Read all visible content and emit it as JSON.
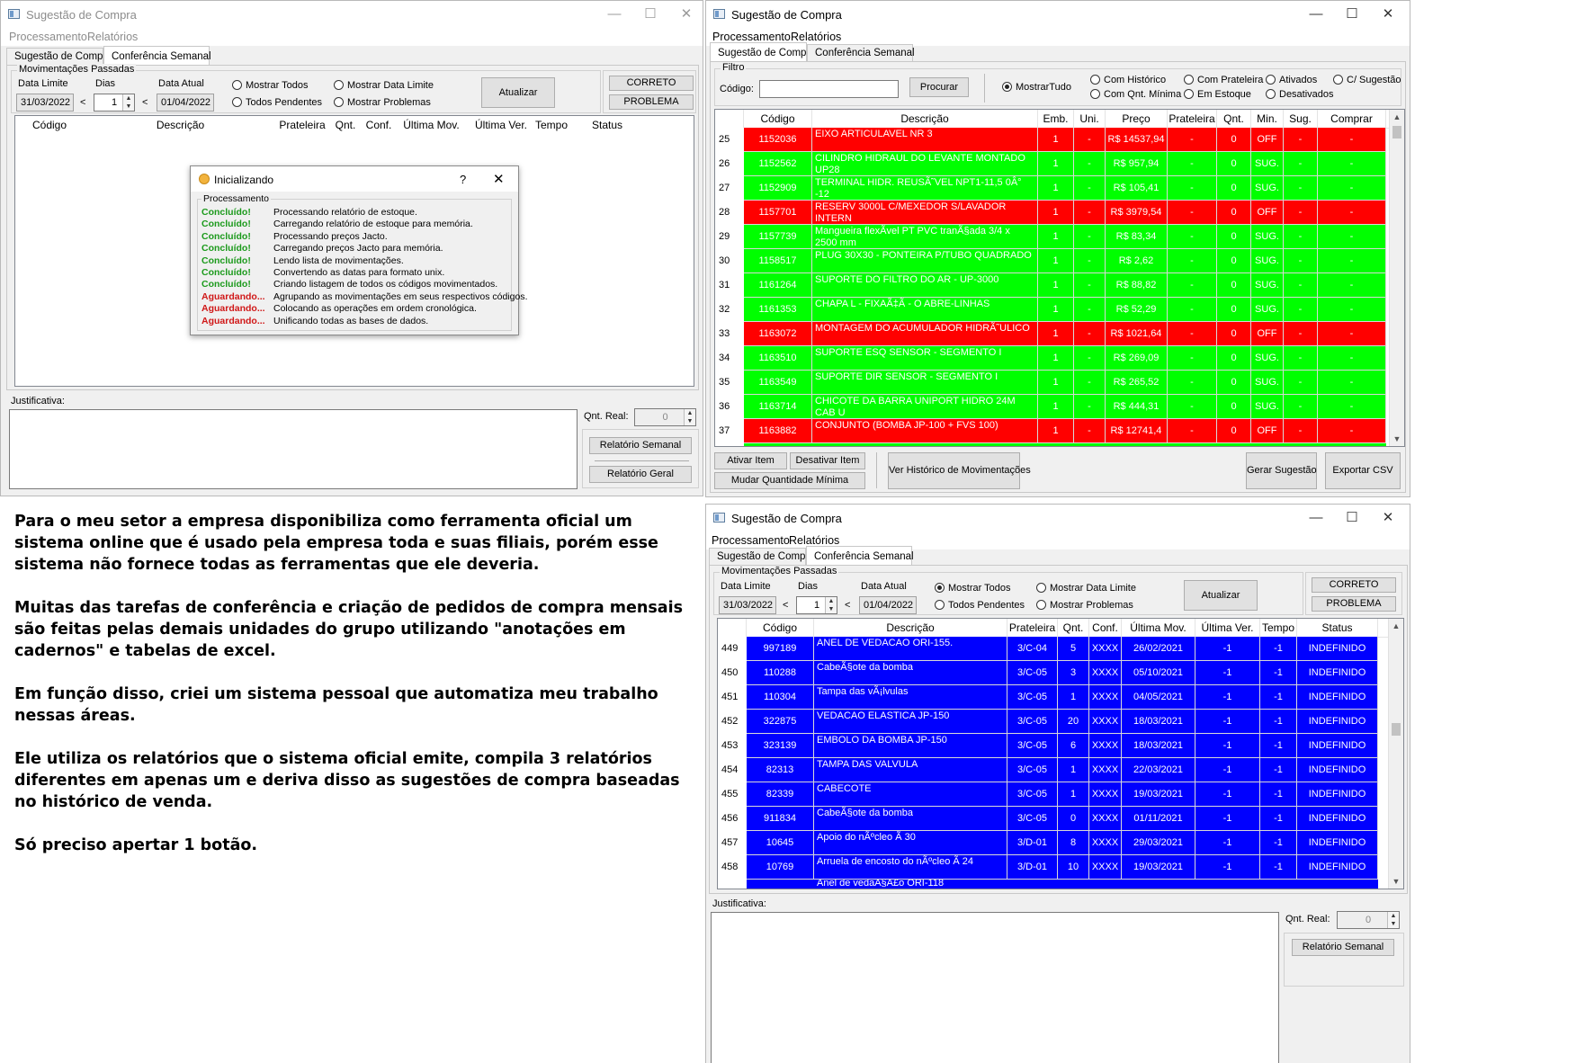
{
  "win1": {
    "title": "Sugestão de Compra",
    "menu": [
      "Processamento",
      "Relatórios"
    ],
    "tabs": [
      "Sugestão de Compra",
      "Conferência Semanal"
    ],
    "group_title": "Movimentações Passadas",
    "data_limite_label": "Data Limite",
    "dias_label": "Dias",
    "data_atual_label": "Data Atual",
    "data_limite": "31/03/2022",
    "dias": "1",
    "data_atual": "01/04/2022",
    "lt": "<",
    "radio_mostrar_todos": "Mostrar Todos",
    "radio_todos_pendentes": "Todos Pendentes",
    "radio_mostrar_data_limite": "Mostrar Data Limite",
    "radio_mostrar_problemas": "Mostrar Problemas",
    "atualizar": "Atualizar",
    "correto": "CORRETO",
    "problema": "PROBLEMA",
    "columns": [
      "Código",
      "Descrição",
      "Prateleira",
      "Qnt.",
      "Conf.",
      "Última Mov.",
      "Última Ver.",
      "Tempo",
      "Status"
    ],
    "justificativa": "Justificativa:",
    "qnt_real_label": "Qnt. Real:",
    "qnt_real": "0",
    "relatorio_semanal": "Relatório Semanal",
    "relatorio_geral": "Relatório Geral"
  },
  "dialog": {
    "title": "Inicializando",
    "help": "?",
    "close": "✕",
    "group": "Processamento",
    "lines": [
      {
        "status": "Concluído!",
        "text": "Processando relatório de estoque."
      },
      {
        "status": "Concluído!",
        "text": "Carregando relatório de estoque para memória."
      },
      {
        "status": "Concluído!",
        "text": "Processando preços Jacto."
      },
      {
        "status": "Concluído!",
        "text": "Carregando preços Jacto para memória."
      },
      {
        "status": "Concluído!",
        "text": "Lendo lista de movimentações."
      },
      {
        "status": "Concluído!",
        "text": "Convertendo as datas para formato unix."
      },
      {
        "status": "Concluído!",
        "text": "Criando listagem de todos os códigos movimentados."
      },
      {
        "status": "Aguardando...",
        "text": "Agrupando as movimentações em seus respectivos códigos."
      },
      {
        "status": "Aguardando...",
        "text": "Colocando as operações em ordem cronológica."
      },
      {
        "status": "Aguardando...",
        "text": "Unificando todas as bases de dados."
      }
    ]
  },
  "win2": {
    "title": "Sugestão de Compra",
    "menu": [
      "Processamento",
      "Relatórios"
    ],
    "tabs": [
      "Sugestão de Compra",
      "Conferência Semanal"
    ],
    "filtro": "Filtro",
    "codigo_label": "Código:",
    "codigo_value": "",
    "procurar": "Procurar",
    "radios": [
      "MostrarTudo",
      "Com Histórico",
      "Com Qnt. Mínima",
      "Com Prateleira",
      "Em Estoque",
      "Ativados",
      "Desativados",
      "C/ Sugestão"
    ],
    "columns": [
      "Código",
      "Descrição",
      "Emb.",
      "Uni.",
      "Preço",
      "Prateleira",
      "Qnt.",
      "Min.",
      "Sug.",
      "Comprar"
    ],
    "rows": [
      {
        "n": "25",
        "codigo": "1152036",
        "desc": "EIXO ARTICULAVEL NR 3",
        "emb": "1",
        "uni": "-",
        "preco": "R$ 14537,94",
        "prat": "-",
        "qnt": "0",
        "min": "OFF",
        "sug": "-",
        "comprar": "-",
        "color": "#ff0000"
      },
      {
        "n": "26",
        "codigo": "1152562",
        "desc": "CILINDRO HIDRAUL DO LEVANTE MONTADO UP28",
        "emb": "1",
        "uni": "-",
        "preco": "R$ 957,94",
        "prat": "-",
        "qnt": "0",
        "min": "SUG.",
        "sug": "-",
        "comprar": "-",
        "color": "#00ff00"
      },
      {
        "n": "27",
        "codigo": "1152909",
        "desc": "TERMINAL HIDR. REUSÃ˜VEL NPT1-11,5 0Â° -12",
        "emb": "1",
        "uni": "-",
        "preco": "R$ 105,41",
        "prat": "-",
        "qnt": "0",
        "min": "SUG.",
        "sug": "-",
        "comprar": "-",
        "color": "#00ff00"
      },
      {
        "n": "28",
        "codigo": "1157701",
        "desc": "RESERV 3000L C/MEXEDOR  S/LAVADOR INTERN",
        "emb": "1",
        "uni": "-",
        "preco": "R$ 3979,54",
        "prat": "-",
        "qnt": "0",
        "min": "OFF",
        "sug": "-",
        "comprar": "-",
        "color": "#ff0000"
      },
      {
        "n": "29",
        "codigo": "1157739",
        "desc": "Mangueira flexÃvel PT PVC tranÃ§ada 3/4 x 2500 mm",
        "emb": "1",
        "uni": "-",
        "preco": "R$ 83,34",
        "prat": "-",
        "qnt": "0",
        "min": "SUG.",
        "sug": "-",
        "comprar": "-",
        "color": "#00ff00"
      },
      {
        "n": "30",
        "codigo": "1158517",
        "desc": "PLUG 30X30 - PONTEIRA P/TUBO QUADRADO",
        "emb": "1",
        "uni": "-",
        "preco": "R$ 2,62",
        "prat": "-",
        "qnt": "0",
        "min": "SUG.",
        "sug": "-",
        "comprar": "-",
        "color": "#00ff00"
      },
      {
        "n": "31",
        "codigo": "1161264",
        "desc": "SUPORTE DO FILTRO DO AR - UP-3000",
        "emb": "1",
        "uni": "-",
        "preco": "R$ 88,82",
        "prat": "-",
        "qnt": "0",
        "min": "SUG.",
        "sug": "-",
        "comprar": "-",
        "color": "#00ff00"
      },
      {
        "n": "32",
        "codigo": "1161353",
        "desc": "CHAPA L - FIXAÃ‡Ã - O ABRE-LINHAS",
        "emb": "1",
        "uni": "-",
        "preco": "R$ 52,29",
        "prat": "-",
        "qnt": "0",
        "min": "SUG.",
        "sug": "-",
        "comprar": "-",
        "color": "#00ff00"
      },
      {
        "n": "33",
        "codigo": "1163072",
        "desc": "MONTAGEM DO ACUMULADOR HIDRÃ˜ULICO",
        "emb": "1",
        "uni": "-",
        "preco": "R$ 1021,64",
        "prat": "-",
        "qnt": "0",
        "min": "OFF",
        "sug": "-",
        "comprar": "-",
        "color": "#ff0000"
      },
      {
        "n": "34",
        "codigo": "1163510",
        "desc": "SUPORTE ESQ SENSOR - SEGMENTO I",
        "emb": "1",
        "uni": "-",
        "preco": "R$ 269,09",
        "prat": "-",
        "qnt": "0",
        "min": "SUG.",
        "sug": "-",
        "comprar": "-",
        "color": "#00ff00"
      },
      {
        "n": "35",
        "codigo": "1163549",
        "desc": "SUPORTE DIR SENSOR - SEGMENTO I",
        "emb": "1",
        "uni": "-",
        "preco": "R$ 265,52",
        "prat": "-",
        "qnt": "0",
        "min": "SUG.",
        "sug": "-",
        "comprar": "-",
        "color": "#00ff00"
      },
      {
        "n": "36",
        "codigo": "1163714",
        "desc": "CHICOTE DA BARRA UNIPORT HIDRO 24M CAB U",
        "emb": "1",
        "uni": "-",
        "preco": "R$ 444,31",
        "prat": "-",
        "qnt": "0",
        "min": "SUG.",
        "sug": "-",
        "comprar": "-",
        "color": "#00ff00"
      },
      {
        "n": "37",
        "codigo": "1163882",
        "desc": "CONJUNTO (BOMBA JP-100 + FVS 100)",
        "emb": "1",
        "uni": "-",
        "preco": "R$ 12741,4",
        "prat": "-",
        "qnt": "0",
        "min": "OFF",
        "sug": "-",
        "comprar": "-",
        "color": "#ff0000"
      }
    ],
    "ativar_item": "Ativar Item",
    "desativar_item": "Desativar Item",
    "mudar_qnt": "Mudar Quantidade Mínima",
    "ver_historico": "Ver Histórico de Movimentações",
    "gerar_sugestao": "Gerar Sugestão",
    "exportar_csv": "Exportar CSV"
  },
  "win3": {
    "title": "Sugestão de Compra",
    "menu": [
      "Processamento",
      "Relatórios"
    ],
    "tabs": [
      "Sugestão de Compra",
      "Conferência Semanal"
    ],
    "group_title": "Movimentações Passadas",
    "data_limite_label": "Data Limite",
    "dias_label": "Dias",
    "data_atual_label": "Data Atual",
    "data_limite": "31/03/2022",
    "dias": "1",
    "data_atual": "01/04/2022",
    "lt": "<",
    "radio_mostrar_todos": "Mostrar Todos",
    "radio_todos_pendentes": "Todos Pendentes",
    "radio_mostrar_data_limite": "Mostrar Data Limite",
    "radio_mostrar_problemas": "Mostrar Problemas",
    "atualizar": "Atualizar",
    "correto": "CORRETO",
    "problema": "PROBLEMA",
    "columns": [
      "Código",
      "Descrição",
      "Prateleira",
      "Qnt.",
      "Conf.",
      "Última Mov.",
      "Última Ver.",
      "Tempo",
      "Status"
    ],
    "rows": [
      {
        "n": "449",
        "codigo": "997189",
        "desc": "ANEL DE VEDACAO ORI-155.",
        "prat": "3/C-04",
        "qnt": "5",
        "conf": "XXXX",
        "mov": "26/02/2021",
        "ver": "-1",
        "tempo": "-1",
        "status": "INDEFINIDO"
      },
      {
        "n": "450",
        "codigo": "110288",
        "desc": "CabeÃ§ote da bomba",
        "prat": "3/C-05",
        "qnt": "3",
        "conf": "XXXX",
        "mov": "05/10/2021",
        "ver": "-1",
        "tempo": "-1",
        "status": "INDEFINIDO"
      },
      {
        "n": "451",
        "codigo": "110304",
        "desc": "Tampa das vÃ¡lvulas",
        "prat": "3/C-05",
        "qnt": "1",
        "conf": "XXXX",
        "mov": "04/05/2021",
        "ver": "-1",
        "tempo": "-1",
        "status": "INDEFINIDO"
      },
      {
        "n": "452",
        "codigo": "322875",
        "desc": "VEDACAO ELASTICA JP-150",
        "prat": "3/C-05",
        "qnt": "20",
        "conf": "XXXX",
        "mov": "18/03/2021",
        "ver": "-1",
        "tempo": "-1",
        "status": "INDEFINIDO"
      },
      {
        "n": "453",
        "codigo": "323139",
        "desc": "EMBOLO DA BOMBA JP-150",
        "prat": "3/C-05",
        "qnt": "6",
        "conf": "XXXX",
        "mov": "18/03/2021",
        "ver": "-1",
        "tempo": "-1",
        "status": "INDEFINIDO"
      },
      {
        "n": "454",
        "codigo": "82313",
        "desc": "TAMPA DAS VALVULA",
        "prat": "3/C-05",
        "qnt": "1",
        "conf": "XXXX",
        "mov": "22/03/2021",
        "ver": "-1",
        "tempo": "-1",
        "status": "INDEFINIDO"
      },
      {
        "n": "455",
        "codigo": "82339",
        "desc": "CABECOTE",
        "prat": "3/C-05",
        "qnt": "1",
        "conf": "XXXX",
        "mov": "19/03/2021",
        "ver": "-1",
        "tempo": "-1",
        "status": "INDEFINIDO"
      },
      {
        "n": "456",
        "codigo": "911834",
        "desc": "CabeÃ§ote da bomba",
        "prat": "3/C-05",
        "qnt": "0",
        "conf": "XXXX",
        "mov": "01/11/2021",
        "ver": "-1",
        "tempo": "-1",
        "status": "INDEFINIDO"
      },
      {
        "n": "457",
        "codigo": "10645",
        "desc": "Apoio do nÃºcleo Ã 30",
        "prat": "3/D-01",
        "qnt": "8",
        "conf": "XXXX",
        "mov": "29/03/2021",
        "ver": "-1",
        "tempo": "-1",
        "status": "INDEFINIDO"
      },
      {
        "n": "458",
        "codigo": "10769",
        "desc": "Arruela de encosto do nÃºcleo Ã 24",
        "prat": "3/D-01",
        "qnt": "10",
        "conf": "XXXX",
        "mov": "19/03/2021",
        "ver": "-1",
        "tempo": "-1",
        "status": "INDEFINIDO"
      }
    ],
    "partial_desc": "Anel de vedaÃ§Ã£o ORI-118",
    "justificativa": "Justificativa:",
    "qnt_real_label": "Qnt. Real:",
    "qnt_real": "0",
    "relatorio_semanal": "Relatório Semanal"
  },
  "caption": [
    "Para o meu setor a empresa disponibiliza como ferramenta oficial um sistema online que é usado pela empresa toda e suas filiais, porém esse sistema não fornece todas as ferramentas que ele deveria.",
    "Muitas das tarefas de conferência e criação de pedidos de compra mensais são feitas pelas demais unidades do grupo utilizando \"anotações em cadernos\" e tabelas de excel.",
    "Em função disso, criei um sistema pessoal que automatiza meu trabalho nessas áreas.",
    "Ele utiliza os relatórios que o sistema oficial emite, compila 3 relatórios diferentes em apenas um e deriva disso as sugestões de compra baseadas no histórico de venda.",
    "Só preciso apertar 1 botão."
  ],
  "colors": {
    "red_row": "#ff0000",
    "green_row": "#00ff00",
    "blue_row": "#0000ff",
    "ok": "#1c9a1c",
    "wait": "#d01818"
  }
}
